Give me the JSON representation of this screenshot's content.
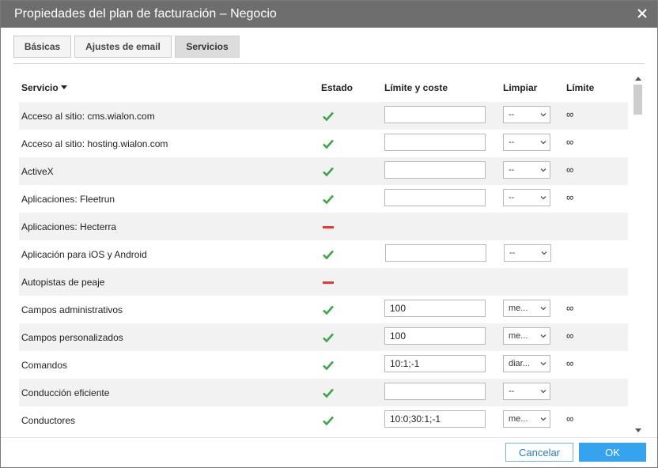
{
  "dialog": {
    "title": "Propiedades del plan de facturación – Negocio",
    "close_icon": "close-icon"
  },
  "tabs": [
    {
      "label": "Básicas",
      "active": false
    },
    {
      "label": "Ajustes de email",
      "active": false
    },
    {
      "label": "Servicios",
      "active": true
    }
  ],
  "table": {
    "headers": {
      "service": "Servicio",
      "status": "Estado",
      "limit_cost": "Límite y coste",
      "reset": "Limpiar",
      "limit": "Límite"
    },
    "rows": [
      {
        "name": "Acceso al sitio: cms.wialon.com",
        "status": "enabled",
        "value": "",
        "reset": "--",
        "limit": "∞",
        "has_controls": true
      },
      {
        "name": "Acceso al sitio: hosting.wialon.com",
        "status": "enabled",
        "value": "",
        "reset": "--",
        "limit": "∞",
        "has_controls": true
      },
      {
        "name": "ActiveX",
        "status": "enabled",
        "value": "",
        "reset": "--",
        "limit": "∞",
        "has_controls": true
      },
      {
        "name": "Aplicaciones: Fleetrun",
        "status": "enabled",
        "value": "",
        "reset": "--",
        "limit": "∞",
        "has_controls": true
      },
      {
        "name": "Aplicaciones: Hecterra",
        "status": "disabled",
        "value": "",
        "reset": "",
        "limit": "",
        "has_controls": false
      },
      {
        "name": "Aplicación para iOS y Android",
        "status": "enabled",
        "value": "",
        "reset": "--",
        "limit": "",
        "has_controls": true
      },
      {
        "name": "Autopistas de peaje",
        "status": "disabled",
        "value": "",
        "reset": "",
        "limit": "",
        "has_controls": false
      },
      {
        "name": "Campos administrativos",
        "status": "enabled",
        "value": "100",
        "reset": "me...",
        "limit": "∞",
        "has_controls": true
      },
      {
        "name": "Campos personalizados",
        "status": "enabled",
        "value": "100",
        "reset": "me...",
        "limit": "∞",
        "has_controls": true
      },
      {
        "name": "Comandos",
        "status": "enabled",
        "value": "10:1;-1",
        "reset": "diar...",
        "limit": "∞",
        "has_controls": true
      },
      {
        "name": "Conducción eficiente",
        "status": "enabled",
        "value": "",
        "reset": "--",
        "limit": "",
        "has_controls": true
      },
      {
        "name": "Conductores",
        "status": "enabled",
        "value": "10:0;30:1;-1",
        "reset": "me...",
        "limit": "∞",
        "has_controls": true
      }
    ]
  },
  "buttons": {
    "cancel": "Cancelar",
    "ok": "OK"
  },
  "colors": {
    "titlebar": "#6e6e6e",
    "check": "#3aa64a",
    "dash": "#e53935",
    "ok_button": "#36a3ef"
  }
}
